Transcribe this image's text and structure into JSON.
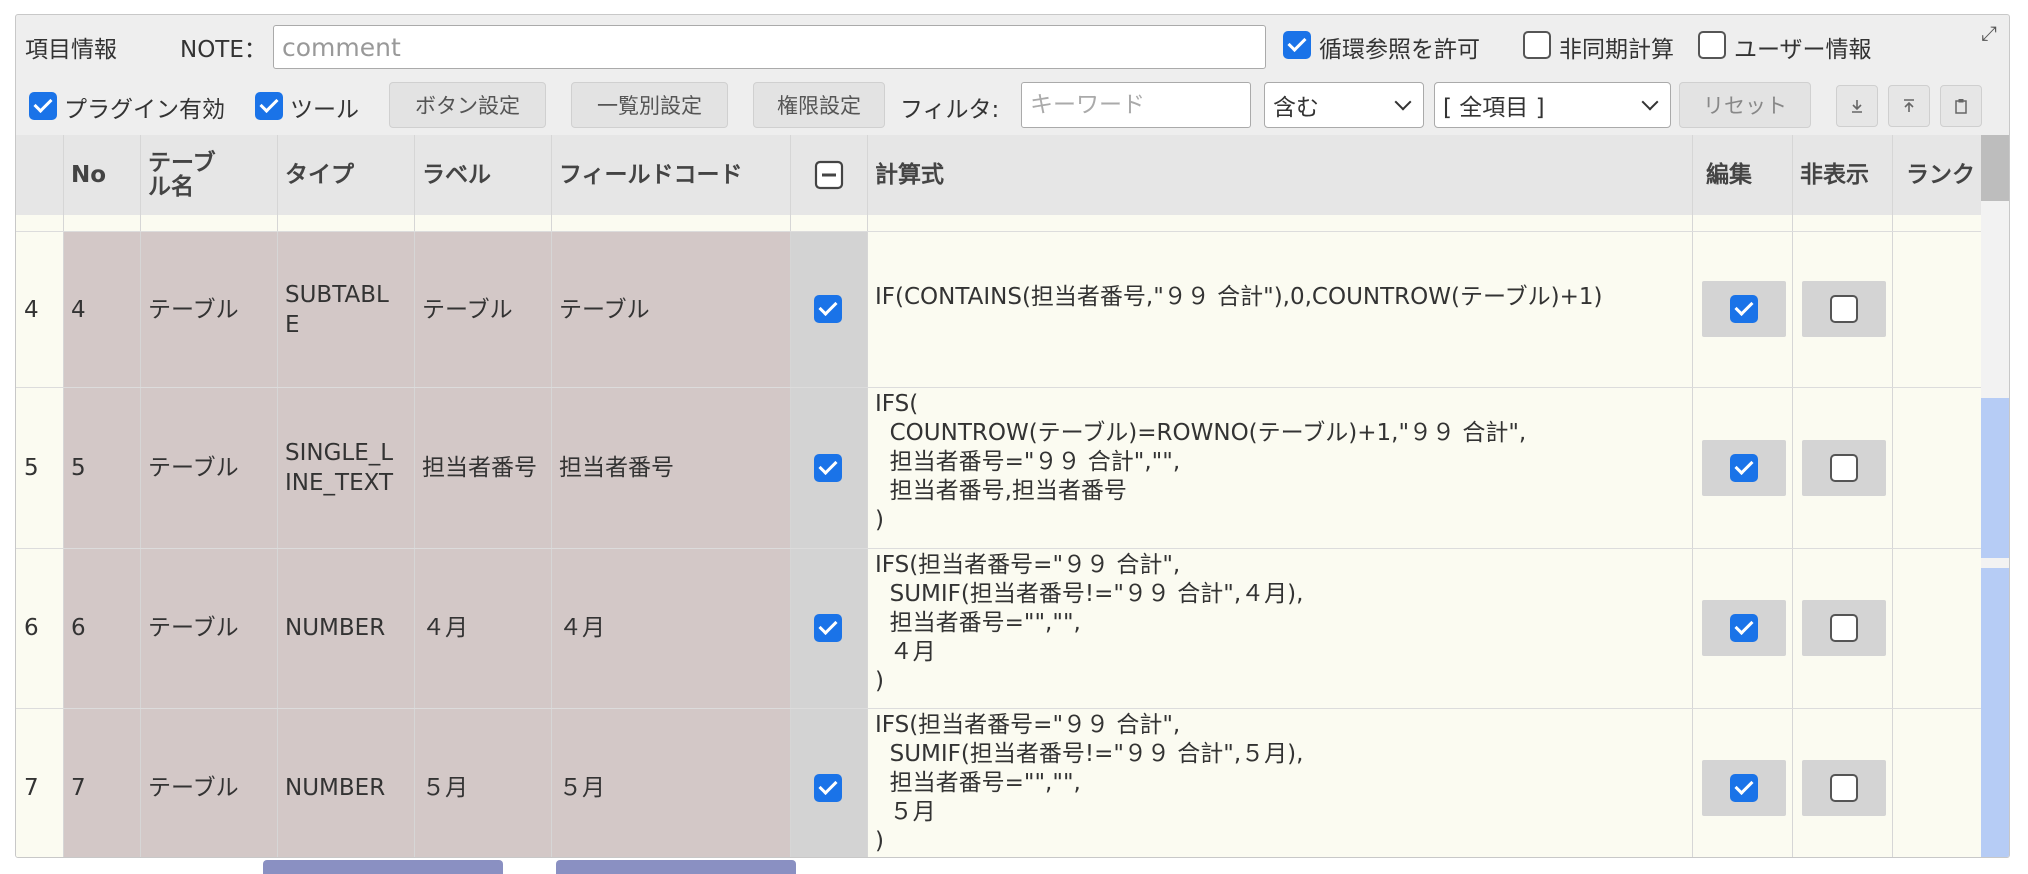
{
  "toolbar": {
    "item_info": "項目情報",
    "note_label": "NOTE：",
    "note_placeholder": "comment",
    "allow_circular": "循環参照を許可",
    "async_calc": "非同期計算",
    "user_info": "ユーザー情報",
    "plugin_enabled": "プラグイン有効",
    "tools": "ツール",
    "button_settings": "ボタン設定",
    "list_settings": "一覧別設定",
    "permission_settings": "権限設定",
    "filter_label": "フィルタ:",
    "keyword_placeholder": "キーワード",
    "match_mode": "含む",
    "field_scope": "[ 全項目 ]",
    "reset": "リセット"
  },
  "checkboxes": {
    "allow_circular": true,
    "async_calc": false,
    "user_info": false,
    "plugin_enabled": true,
    "tools": true
  },
  "icons": {
    "expand": "expand-icon",
    "download": "download-icon",
    "upload": "upload-icon",
    "clipboard": "clipboard-icon",
    "collapse": "minus-square-icon"
  },
  "columns": {
    "no": "No",
    "table_name": "テーブル名",
    "type": "タイプ",
    "label": "ラベル",
    "field_code": "フィールドコード",
    "formula": "計算式",
    "edit": "編集",
    "hidden": "非表示",
    "rank": "ランク"
  },
  "rows": [
    {
      "index": "4",
      "no": "4",
      "table": "テーブル",
      "type1": "SUBTABL",
      "type2": "E",
      "label": "テーブル",
      "code": "テーブル",
      "formula": "IF(CONTAINS(担当者番号,\"９９ 合計\"),0,COUNTROW(テーブル)+1)",
      "enabled": true,
      "edit": true,
      "hidden": false
    },
    {
      "index": "5",
      "no": "5",
      "table": "テーブル",
      "type1": "SINGLE_L",
      "type2": "INE_TEXT",
      "label": "担当者番号",
      "code": "担当者番号",
      "formula": "IFS(\n  COUNTROW(テーブル)=ROWNO(テーブル)+1,\"９９ 合計\",\n  担当者番号=\"９９ 合計\",\"\",\n  担当者番号,担当者番号\n)",
      "enabled": true,
      "edit": true,
      "hidden": false
    },
    {
      "index": "6",
      "no": "6",
      "table": "テーブル",
      "type1": "NUMBER",
      "type2": "",
      "label": "４月",
      "code": "４月",
      "formula": "IFS(担当者番号=\"９９ 合計\",\n  SUMIF(担当者番号!=\"９９ 合計\",４月),\n  担当者番号=\"\",\"\",\n  ４月\n)",
      "enabled": true,
      "edit": true,
      "hidden": false
    },
    {
      "index": "7",
      "no": "7",
      "table": "テーブル",
      "type1": "NUMBER",
      "type2": "",
      "label": "５月",
      "code": "５月",
      "formula": "IFS(担当者番号=\"９９ 合計\",\n  SUMIF(担当者番号!=\"９９ 合計\",５月),\n  担当者番号=\"\",\"\",\n  ５月\n)",
      "enabled": true,
      "edit": true,
      "hidden": false
    }
  ]
}
